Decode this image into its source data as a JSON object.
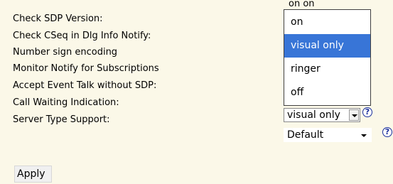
{
  "labels": [
    "Check SDP Version:",
    "Check CSeq in Dlg Info Notify:",
    "Number sign encoding",
    "Monitor Notify for Subscriptions",
    "Accept Event Talk without SDP:",
    "Call Waiting Indication:",
    "Server Type Support:"
  ],
  "call_waiting": {
    "value": "visual only",
    "options": [
      "on",
      "visual only",
      "ringer",
      "off"
    ],
    "highlighted_option": "visual only"
  },
  "server_type": {
    "value": "Default"
  },
  "help_symbol": "?",
  "peek_text": "on  on  ",
  "apply_label": "Apply",
  "colors": {
    "page_background": "#fbf8e8",
    "highlight": "#3875d7",
    "help_icon": "#1a2f9c"
  }
}
